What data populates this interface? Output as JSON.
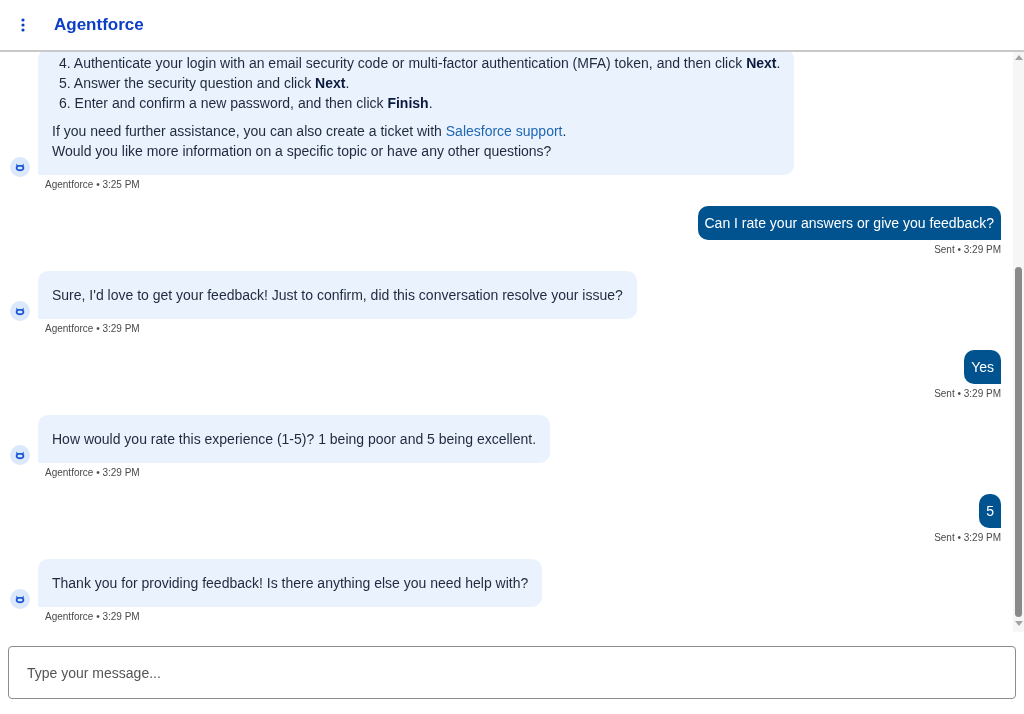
{
  "header": {
    "title": "Agentforce"
  },
  "messages": [
    {
      "kind": "bot",
      "steps": [
        "4. Authenticate your login with an email security code or multi-factor authentication (MFA) token, and then click **Next**.",
        "5. Answer the security question and click **Next**.",
        "6. Enter and confirm a new password, and then click **Finish**."
      ],
      "paragraphs": [
        {
          "before": "If you need further assistance, you can also create a ticket with ",
          "link": "Salesforce support",
          "after": "."
        },
        {
          "before": "Would you like more information on a specific topic or have any other questions?"
        }
      ],
      "meta": "Agentforce • 3:25 PM"
    },
    {
      "kind": "user",
      "text": "Can I rate your answers or give you feedback?",
      "meta": "Sent • 3:29 PM"
    },
    {
      "kind": "bot",
      "paragraphs": [
        {
          "before": "Sure, I'd love to get your feedback! Just to confirm, did this conversation resolve your issue?"
        }
      ],
      "meta": "Agentforce • 3:29 PM"
    },
    {
      "kind": "user",
      "text": "Yes",
      "meta": "Sent • 3:29 PM"
    },
    {
      "kind": "bot",
      "paragraphs": [
        {
          "before": "How would you rate this experience (1-5)? 1 being poor and 5 being excellent."
        }
      ],
      "meta": "Agentforce • 3:29 PM"
    },
    {
      "kind": "user",
      "text": "5",
      "meta": "Sent • 3:29 PM"
    },
    {
      "kind": "bot",
      "paragraphs": [
        {
          "before": "Thank you for providing feedback! Is there anything else you need help with?"
        }
      ],
      "meta": "Agentforce • 3:29 PM"
    }
  ],
  "composer": {
    "placeholder": "Type your message..."
  }
}
